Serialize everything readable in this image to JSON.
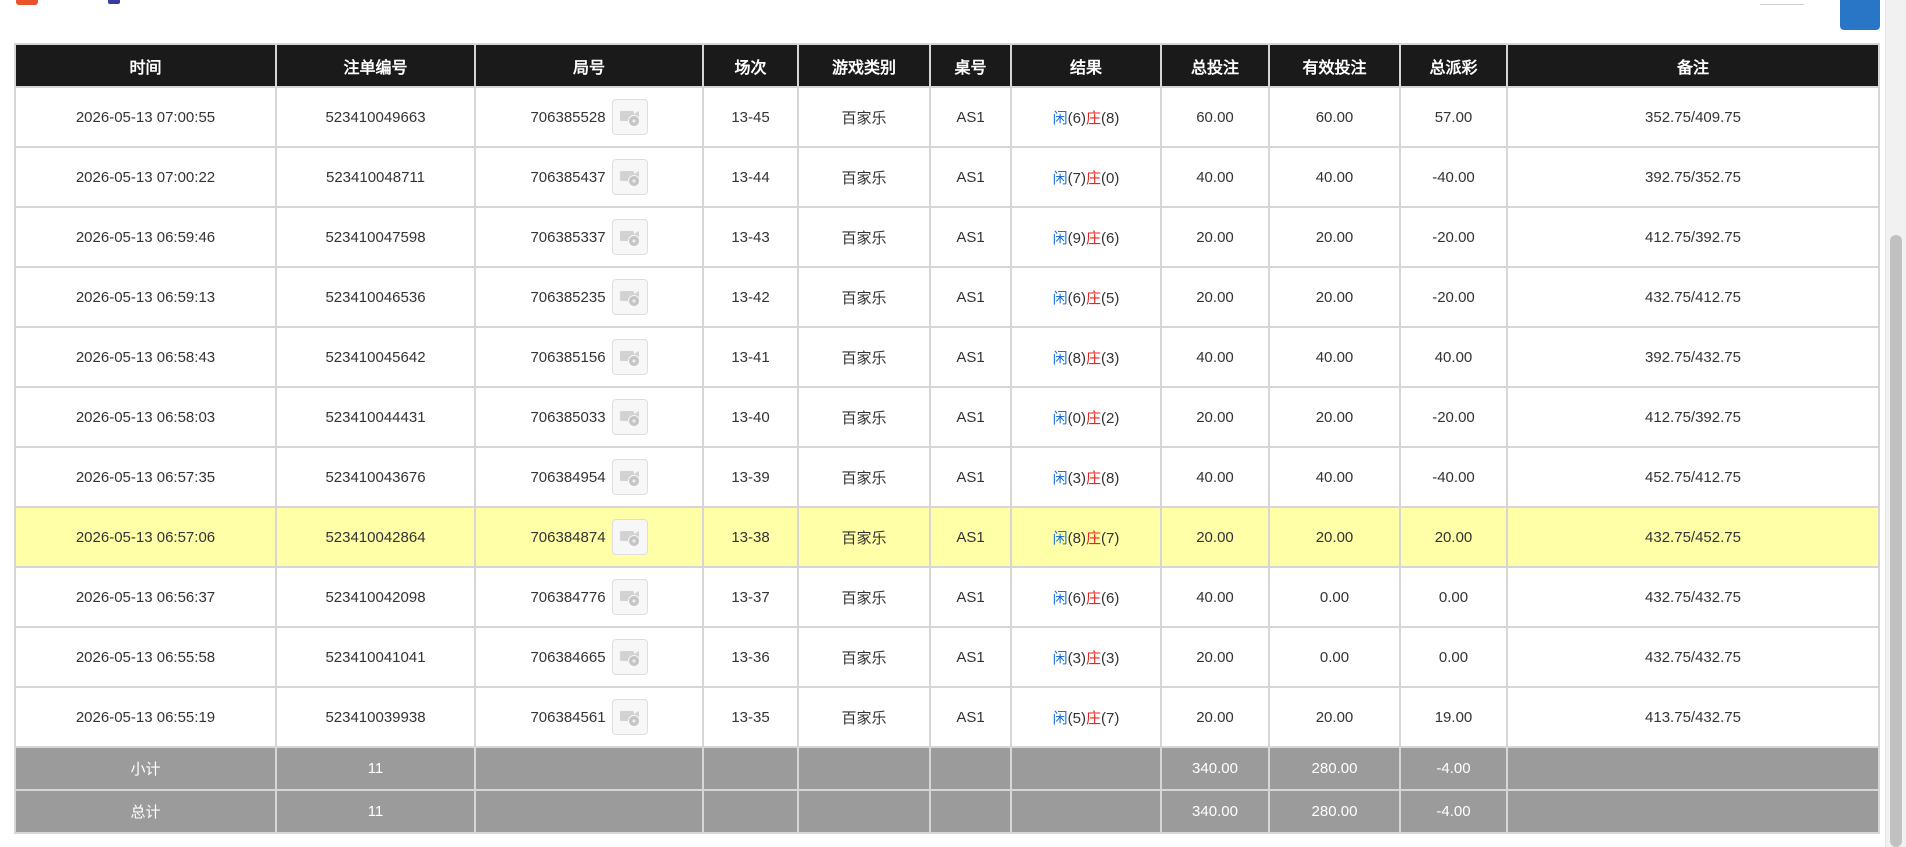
{
  "colors": {
    "header_bg": "#1a1a1a",
    "footer_bg": "#9b9b9b",
    "highlight_row": "#ffffa8",
    "blue_text": "#1b6fd6",
    "red_text": "#e8231f",
    "corner_button": "#2a76c6"
  },
  "table": {
    "headers": [
      "时间",
      "注单编号",
      "局号",
      "场次",
      "游戏类别",
      "桌号",
      "结果",
      "总投注",
      "有效投注",
      "总派彩",
      "备注"
    ],
    "replay_icon": "replay-video-icon",
    "rows": [
      {
        "time": "2026-05-13 07:00:55",
        "bet_no": "523410049663",
        "round": "706385528",
        "shoe": "13-45",
        "game": "百家乐",
        "table": "AS1",
        "player_label": "闲",
        "player": "(6)",
        "banker_label": "庄",
        "banker": "(8)",
        "total_bet": "60.00",
        "valid_bet": "60.00",
        "payout": "57.00",
        "payout_negative": false,
        "note": "352.75/409.75",
        "highlight": false
      },
      {
        "time": "2026-05-13 07:00:22",
        "bet_no": "523410048711",
        "round": "706385437",
        "shoe": "13-44",
        "game": "百家乐",
        "table": "AS1",
        "player_label": "闲",
        "player": "(7)",
        "banker_label": "庄",
        "banker": "(0)",
        "total_bet": "40.00",
        "valid_bet": "40.00",
        "payout": "-40.00",
        "payout_negative": true,
        "note": "392.75/352.75",
        "highlight": false
      },
      {
        "time": "2026-05-13 06:59:46",
        "bet_no": "523410047598",
        "round": "706385337",
        "shoe": "13-43",
        "game": "百家乐",
        "table": "AS1",
        "player_label": "闲",
        "player": "(9)",
        "banker_label": "庄",
        "banker": "(6)",
        "total_bet": "20.00",
        "valid_bet": "20.00",
        "payout": "-20.00",
        "payout_negative": true,
        "note": "412.75/392.75",
        "highlight": false
      },
      {
        "time": "2026-05-13 06:59:13",
        "bet_no": "523410046536",
        "round": "706385235",
        "shoe": "13-42",
        "game": "百家乐",
        "table": "AS1",
        "player_label": "闲",
        "player": "(6)",
        "banker_label": "庄",
        "banker": "(5)",
        "total_bet": "20.00",
        "valid_bet": "20.00",
        "payout": "-20.00",
        "payout_negative": true,
        "note": "432.75/412.75",
        "highlight": false
      },
      {
        "time": "2026-05-13 06:58:43",
        "bet_no": "523410045642",
        "round": "706385156",
        "shoe": "13-41",
        "game": "百家乐",
        "table": "AS1",
        "player_label": "闲",
        "player": "(8)",
        "banker_label": "庄",
        "banker": "(3)",
        "total_bet": "40.00",
        "valid_bet": "40.00",
        "payout": "40.00",
        "payout_negative": false,
        "note": "392.75/432.75",
        "highlight": false
      },
      {
        "time": "2026-05-13 06:58:03",
        "bet_no": "523410044431",
        "round": "706385033",
        "shoe": "13-40",
        "game": "百家乐",
        "table": "AS1",
        "player_label": "闲",
        "player": "(0)",
        "banker_label": "庄",
        "banker": "(2)",
        "total_bet": "20.00",
        "valid_bet": "20.00",
        "payout": "-20.00",
        "payout_negative": true,
        "note": "412.75/392.75",
        "highlight": false
      },
      {
        "time": "2026-05-13 06:57:35",
        "bet_no": "523410043676",
        "round": "706384954",
        "shoe": "13-39",
        "game": "百家乐",
        "table": "AS1",
        "player_label": "闲",
        "player": "(3)",
        "banker_label": "庄",
        "banker": "(8)",
        "total_bet": "40.00",
        "valid_bet": "40.00",
        "payout": "-40.00",
        "payout_negative": true,
        "note": "452.75/412.75",
        "highlight": false
      },
      {
        "time": "2026-05-13 06:57:06",
        "bet_no": "523410042864",
        "round": "706384874",
        "shoe": "13-38",
        "game": "百家乐",
        "table": "AS1",
        "player_label": "闲",
        "player": "(8)",
        "banker_label": "庄",
        "banker": "(7)",
        "total_bet": "20.00",
        "valid_bet": "20.00",
        "payout": "20.00",
        "payout_negative": false,
        "note": "432.75/452.75",
        "highlight": true
      },
      {
        "time": "2026-05-13 06:56:37",
        "bet_no": "523410042098",
        "round": "706384776",
        "shoe": "13-37",
        "game": "百家乐",
        "table": "AS1",
        "player_label": "闲",
        "player": "(6)",
        "banker_label": "庄",
        "banker": "(6)",
        "total_bet": "40.00",
        "valid_bet": "0.00",
        "payout": "0.00",
        "payout_negative": false,
        "note": "432.75/432.75",
        "highlight": false
      },
      {
        "time": "2026-05-13 06:55:58",
        "bet_no": "523410041041",
        "round": "706384665",
        "shoe": "13-36",
        "game": "百家乐",
        "table": "AS1",
        "player_label": "闲",
        "player": "(3)",
        "banker_label": "庄",
        "banker": "(3)",
        "total_bet": "20.00",
        "valid_bet": "0.00",
        "payout": "0.00",
        "payout_negative": false,
        "note": "432.75/432.75",
        "highlight": false
      },
      {
        "time": "2026-05-13 06:55:19",
        "bet_no": "523410039938",
        "round": "706384561",
        "shoe": "13-35",
        "game": "百家乐",
        "table": "AS1",
        "player_label": "闲",
        "player": "(5)",
        "banker_label": "庄",
        "banker": "(7)",
        "total_bet": "20.00",
        "valid_bet": "20.00",
        "payout": "19.00",
        "payout_negative": false,
        "note": "413.75/432.75",
        "highlight": false
      }
    ],
    "footer": [
      {
        "label": "小计",
        "count": "11",
        "total_bet": "340.00",
        "valid_bet": "280.00",
        "payout": "-4.00"
      },
      {
        "label": "总计",
        "count": "11",
        "total_bet": "340.00",
        "valid_bet": "280.00",
        "payout": "-4.00"
      }
    ]
  }
}
